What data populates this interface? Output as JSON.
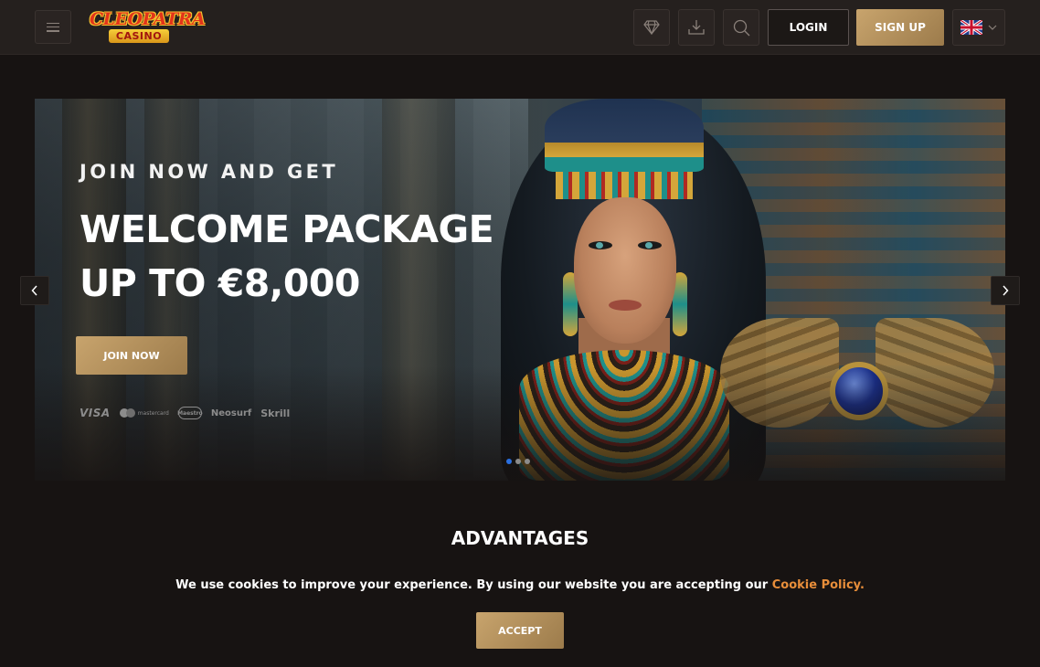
{
  "header": {
    "logo_top": "CLEOPATRA",
    "logo_bottom": "CASINO",
    "login_label": "LOGIN",
    "signup_label": "SIGN UP",
    "icons": [
      "menu-icon",
      "diamond-icon",
      "download-icon",
      "search-icon",
      "uk-flag-icon",
      "chevron-down-icon"
    ]
  },
  "hero": {
    "subtitle": "JOIN NOW AND GET",
    "title_line1": "WELCOME PACKAGE",
    "title_line2": "UP TO €8,000",
    "cta_label": "JOIN NOW",
    "payments": {
      "visa": "VISA",
      "mastercard": "mastercard",
      "maestro": "Maestro",
      "neosurf": "Neosurf",
      "skrill": "Skrill"
    },
    "slides_total": 3,
    "slide_active": 1
  },
  "advantages": {
    "title": "ADVANTAGES"
  },
  "cookie": {
    "text": "We use cookies to improve your experience. By using our website you are accepting our ",
    "link_text": "Cookie Policy.",
    "accept_label": "ACCEPT"
  },
  "colors": {
    "background": "#171312",
    "header": "#25201e",
    "gold": "#b8955e",
    "link": "#e88e3a",
    "active_dot": "#2a6fe0"
  }
}
